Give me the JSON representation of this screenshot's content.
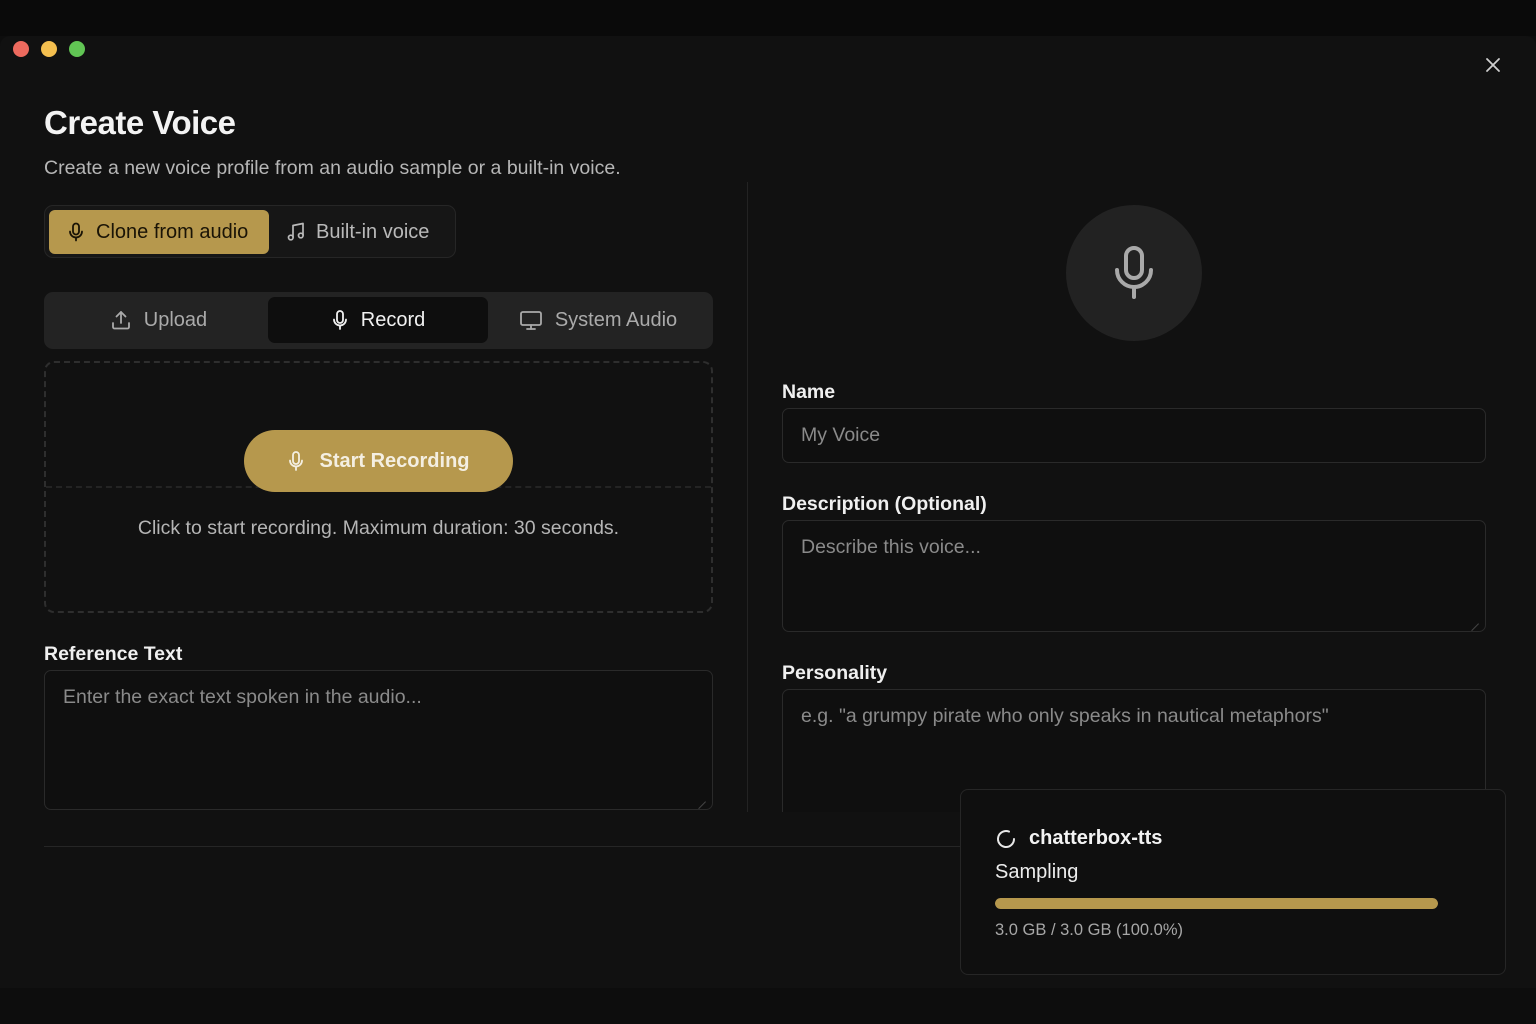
{
  "window": {
    "close_icon": "x-icon"
  },
  "header": {
    "title": "Create Voice",
    "subtitle": "Create a new voice profile from an audio sample or a built-in voice."
  },
  "mode_switch": {
    "options": [
      {
        "label": "Clone from audio",
        "icon": "microphone-icon",
        "active": true
      },
      {
        "label": "Built-in voice",
        "icon": "music-note-icon",
        "active": false
      }
    ]
  },
  "source_tabs": [
    {
      "label": "Upload",
      "icon": "upload-icon",
      "active": false
    },
    {
      "label": "Record",
      "icon": "microphone-icon",
      "active": true
    },
    {
      "label": "System Audio",
      "icon": "monitor-icon",
      "active": false
    }
  ],
  "recorder": {
    "button_label": "Start Recording",
    "hint": "Click to start recording. Maximum duration: 30 seconds."
  },
  "reference_text": {
    "label": "Reference Text",
    "placeholder": "Enter the exact text spoken in the audio...",
    "value": ""
  },
  "profile": {
    "avatar_icon": "microphone-icon",
    "name": {
      "label": "Name",
      "placeholder": "My Voice",
      "value": ""
    },
    "description": {
      "label": "Description (Optional)",
      "placeholder": "Describe this voice...",
      "value": ""
    },
    "personality": {
      "label": "Personality",
      "placeholder": "e.g. \"a grumpy pirate who only speaks in nautical metaphors\"",
      "value": ""
    }
  },
  "download_toast": {
    "icon": "spinner-icon",
    "model": "chatterbox-tts",
    "status": "Sampling",
    "progress_percent": 100.0,
    "size_text": "3.0 GB / 3.0 GB (100.0%)"
  },
  "colors": {
    "accent": "#b6984d",
    "background": "#111111",
    "traffic_red": "#ed6a5e",
    "traffic_yellow": "#f4bf4f",
    "traffic_green": "#61c554"
  }
}
